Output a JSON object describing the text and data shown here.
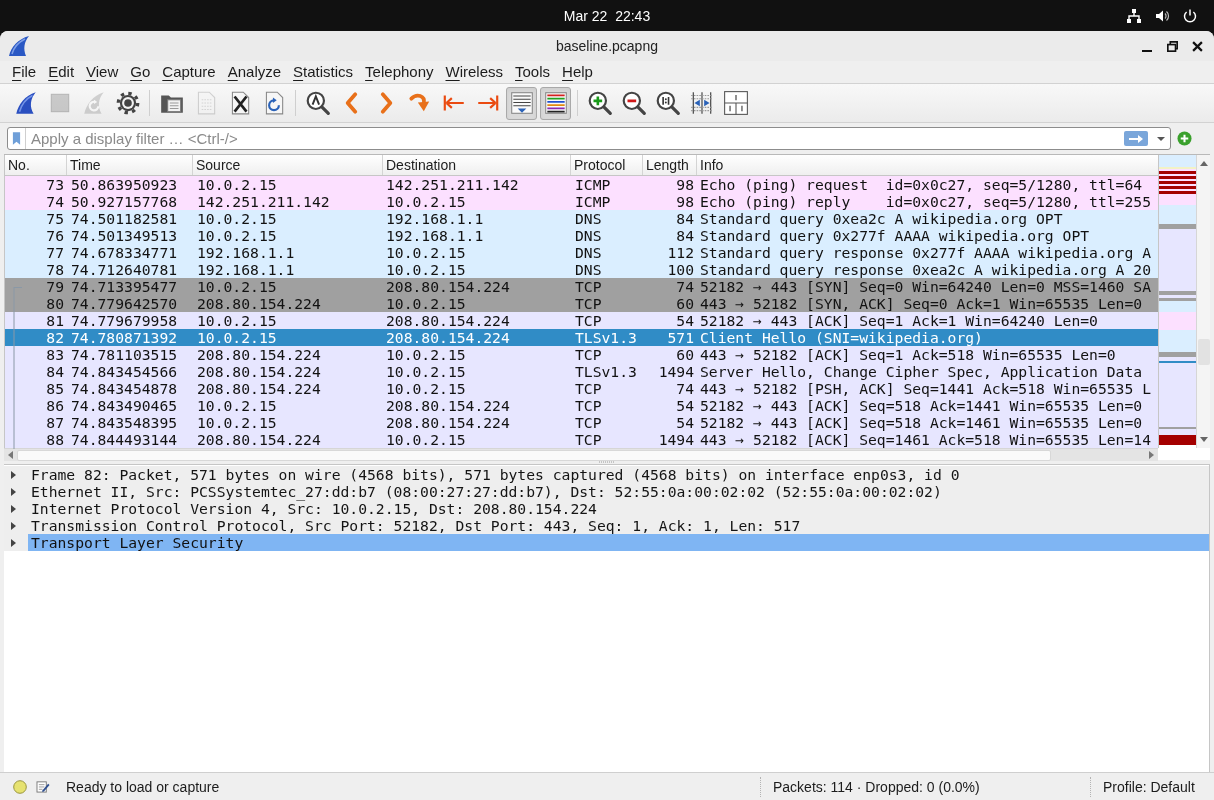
{
  "top_bar": {
    "clock": "Mar 22  22:43"
  },
  "window": {
    "title": "baseline.pcapng"
  },
  "menu": [
    "File",
    "Edit",
    "View",
    "Go",
    "Capture",
    "Analyze",
    "Statistics",
    "Telephony",
    "Wireless",
    "Tools",
    "Help"
  ],
  "toolbar": [
    [
      {
        "kind": "start",
        "disabled": false,
        "on": false
      },
      {
        "kind": "stop",
        "disabled": true,
        "on": false
      },
      {
        "kind": "restart",
        "disabled": true,
        "on": false
      },
      {
        "kind": "options",
        "disabled": false,
        "on": false
      }
    ],
    [
      {
        "kind": "open",
        "disabled": false,
        "on": false
      },
      {
        "kind": "save",
        "disabled": true,
        "on": false
      },
      {
        "kind": "close",
        "disabled": false,
        "on": false
      },
      {
        "kind": "reload",
        "disabled": false,
        "on": false
      }
    ],
    [
      {
        "kind": "find",
        "disabled": false,
        "on": false
      },
      {
        "kind": "back",
        "disabled": false,
        "on": false
      },
      {
        "kind": "forward",
        "disabled": false,
        "on": false
      },
      {
        "kind": "goto",
        "disabled": false,
        "on": false
      },
      {
        "kind": "first",
        "disabled": false,
        "on": false
      },
      {
        "kind": "last",
        "disabled": false,
        "on": false
      },
      {
        "kind": "autoscroll",
        "disabled": false,
        "on": true
      },
      {
        "kind": "colorize",
        "disabled": false,
        "on": true
      }
    ],
    [
      {
        "kind": "zoom_in",
        "disabled": false,
        "on": false
      },
      {
        "kind": "zoom_out",
        "disabled": false,
        "on": false
      },
      {
        "kind": "zoom_reset",
        "disabled": false,
        "on": false
      },
      {
        "kind": "resize_columns",
        "disabled": false,
        "on": false
      },
      {
        "kind": "layout",
        "disabled": false,
        "on": false
      }
    ]
  ],
  "display_filter": {
    "placeholder": "Apply a display filter … <Ctrl-/>"
  },
  "packet_list": {
    "columns": [
      "No.",
      "Time",
      "Source",
      "Destination",
      "Protocol",
      "Length",
      "Info"
    ],
    "rows": [
      {
        "no": "73",
        "time": "50.863950923",
        "source": "10.0.2.15",
        "destination": "142.251.211.142",
        "protocol": "ICMP",
        "length": "98",
        "info": "Echo (ping) request  id=0x0c27, seq=5/1280, ttl=64",
        "color": "#fce0ff",
        "selected": false
      },
      {
        "no": "74",
        "time": "50.927157768",
        "source": "142.251.211.142",
        "destination": "10.0.2.15",
        "protocol": "ICMP",
        "length": "98",
        "info": "Echo (ping) reply    id=0x0c27, seq=5/1280, ttl=255",
        "color": "#fce0ff",
        "selected": false
      },
      {
        "no": "75",
        "time": "74.501182581",
        "source": "10.0.2.15",
        "destination": "192.168.1.1",
        "protocol": "DNS",
        "length": "84",
        "info": "Standard query 0xea2c A wikipedia.org OPT",
        "color": "#daeeff",
        "selected": false
      },
      {
        "no": "76",
        "time": "74.501349513",
        "source": "10.0.2.15",
        "destination": "192.168.1.1",
        "protocol": "DNS",
        "length": "84",
        "info": "Standard query 0x277f AAAA wikipedia.org OPT",
        "color": "#daeeff",
        "selected": false
      },
      {
        "no": "77",
        "time": "74.678334771",
        "source": "192.168.1.1",
        "destination": "10.0.2.15",
        "protocol": "DNS",
        "length": "112",
        "info": "Standard query response 0x277f AAAA wikipedia.org A",
        "color": "#daeeff",
        "selected": false
      },
      {
        "no": "78",
        "time": "74.712640781",
        "source": "192.168.1.1",
        "destination": "10.0.2.15",
        "protocol": "DNS",
        "length": "100",
        "info": "Standard query response 0xea2c A wikipedia.org A 20",
        "color": "#daeeff",
        "selected": false
      },
      {
        "no": "79",
        "time": "74.713395477",
        "source": "10.0.2.15",
        "destination": "208.80.154.224",
        "protocol": "TCP",
        "length": "74",
        "info": "52182 → 443 [SYN] Seq=0 Win=64240 Len=0 MSS=1460 SA",
        "color": "#a0a0a0",
        "selected": false
      },
      {
        "no": "80",
        "time": "74.779642570",
        "source": "208.80.154.224",
        "destination": "10.0.2.15",
        "protocol": "TCP",
        "length": "60",
        "info": "443 → 52182 [SYN, ACK] Seq=0 Ack=1 Win=65535 Len=0",
        "color": "#a0a0a0",
        "selected": false
      },
      {
        "no": "81",
        "time": "74.779679958",
        "source": "10.0.2.15",
        "destination": "208.80.154.224",
        "protocol": "TCP",
        "length": "54",
        "info": "52182 → 443 [ACK] Seq=1 Ack=1 Win=64240 Len=0",
        "color": "#e7e6ff",
        "selected": false
      },
      {
        "no": "82",
        "time": "74.780871392",
        "source": "10.0.2.15",
        "destination": "208.80.154.224",
        "protocol": "TLSv1.3",
        "length": "571",
        "info": "Client Hello (SNI=wikipedia.org)",
        "selected": true
      },
      {
        "no": "83",
        "time": "74.781103515",
        "source": "208.80.154.224",
        "destination": "10.0.2.15",
        "protocol": "TCP",
        "length": "60",
        "info": "443 → 52182 [ACK] Seq=1 Ack=518 Win=65535 Len=0",
        "color": "#e7e6ff",
        "selected": false
      },
      {
        "no": "84",
        "time": "74.843454566",
        "source": "208.80.154.224",
        "destination": "10.0.2.15",
        "protocol": "TLSv1.3",
        "length": "1494",
        "info": "Server Hello, Change Cipher Spec, Application Data",
        "color": "#e7e6ff",
        "selected": false
      },
      {
        "no": "85",
        "time": "74.843454878",
        "source": "208.80.154.224",
        "destination": "10.0.2.15",
        "protocol": "TCP",
        "length": "74",
        "info": "443 → 52182 [PSH, ACK] Seq=1441 Ack=518 Win=65535 L",
        "color": "#e7e6ff",
        "selected": false
      },
      {
        "no": "86",
        "time": "74.843490465",
        "source": "10.0.2.15",
        "destination": "208.80.154.224",
        "protocol": "TCP",
        "length": "54",
        "info": "52182 → 443 [ACK] Seq=518 Ack=1441 Win=65535 Len=0",
        "color": "#e7e6ff",
        "selected": false
      },
      {
        "no": "87",
        "time": "74.843548395",
        "source": "10.0.2.15",
        "destination": "208.80.154.224",
        "protocol": "TCP",
        "length": "54",
        "info": "52182 → 443 [ACK] Seq=518 Ack=1461 Win=65535 Len=0",
        "color": "#e7e6ff",
        "selected": false
      },
      {
        "no": "88",
        "time": "74.844493144",
        "source": "208.80.154.224",
        "destination": "10.0.2.15",
        "protocol": "TCP",
        "length": "1494",
        "info": "443 → 52182 [ACK] Seq=1461 Ack=518 Win=65535 Len=14",
        "color": "#e7e6ff",
        "selected": false
      }
    ]
  },
  "packet_details": [
    {
      "text": "Frame 82: Packet, 571 bytes on wire (4568 bits), 571 bytes captured (4568 bits) on interface enp0s3, id 0",
      "expanded": false,
      "selected": false
    },
    {
      "text": "Ethernet II, Src: PCSSystemtec_27:dd:b7 (08:00:27:27:dd:b7), Dst: 52:55:0a:00:02:02 (52:55:0a:00:02:02)",
      "expanded": false,
      "selected": false
    },
    {
      "text": "Internet Protocol Version 4, Src: 10.0.2.15, Dst: 208.80.154.224",
      "expanded": false,
      "selected": false
    },
    {
      "text": "Transmission Control Protocol, Src Port: 52182, Dst Port: 443, Seq: 1, Ack: 1, Len: 517",
      "expanded": false,
      "selected": false
    },
    {
      "text": "Transport Layer Security",
      "expanded": false,
      "selected": true
    }
  ],
  "status_bar": {
    "message": "Ready to load or capture",
    "packets": "Packets: 114 · Dropped: 0 (0.0%)",
    "profile": "Profile: Default"
  }
}
